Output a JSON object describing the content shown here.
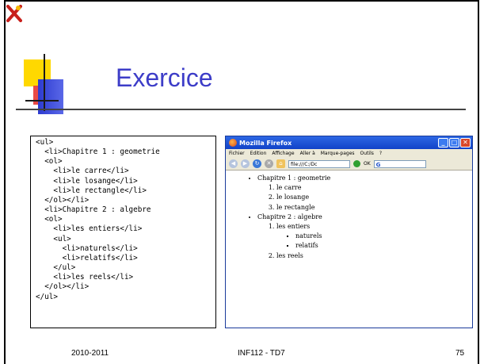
{
  "slide": {
    "title": "Exercice",
    "footer_left": "2010-2011",
    "footer_center": "INF112 - TD7",
    "page_number": "75"
  },
  "code": {
    "lines": [
      "<ul>",
      "  <li>Chapitre 1 : geometrie",
      "  <ol>",
      "    <li>le carre</li>",
      "    <li>le losange</li>",
      "    <li>le rectangle</li>",
      "  </ol></li>",
      "  <li>Chapitre 2 : algebre",
      "  <ol>",
      "    <li>les entiers</li>",
      "    <ul>",
      "      <li>naturels</li>",
      "      <li>relatifs</li>",
      "    </ul>",
      "    <li>les reels</li>",
      "  </ol></li>",
      "</ul>"
    ]
  },
  "browser": {
    "window_title": "Mozilla Firefox",
    "menu": [
      "Fichier",
      "Edition",
      "Affichage",
      "Aller à",
      "Marque-pages",
      "Outils",
      "?"
    ],
    "url": "file:///C:/Dc",
    "ok_label": "OK",
    "search_value": "G",
    "content": {
      "chap1": "Chapitre 1 : geometrie",
      "chap1_items": [
        "le carre",
        "le losange",
        "le rectangle"
      ],
      "chap2": "Chapitre 2 : algebre",
      "entiers": "les entiers",
      "entiers_items": [
        "naturels",
        "relatifs"
      ],
      "reels": "les reels"
    }
  }
}
